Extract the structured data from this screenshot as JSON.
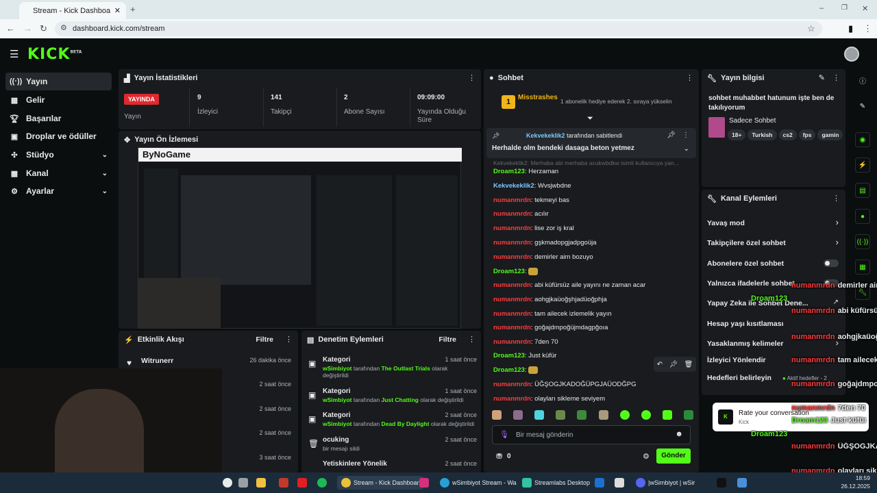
{
  "browser": {
    "tab_title": "Stream - Kick Dashboard",
    "url": "dashboard.kick.com/stream"
  },
  "header": {
    "logo": "KICK",
    "logo_badge": "BETA"
  },
  "sidebar": {
    "items": [
      {
        "label": "Yayın",
        "icon": "broadcast-icon"
      },
      {
        "label": "Gelir",
        "icon": "revenue-icon"
      },
      {
        "label": "Başarılar",
        "icon": "trophy-icon"
      },
      {
        "label": "Droplar ve ödüller",
        "icon": "gift-icon"
      },
      {
        "label": "Stüdyo",
        "icon": "studio-icon"
      },
      {
        "label": "Kanal",
        "icon": "channel-icon"
      },
      {
        "label": "Ayarlar",
        "icon": "gear-icon"
      }
    ]
  },
  "stats": {
    "title": "Yayın İstatistikleri",
    "live_badge": "YAYINDA",
    "live_label": "Yayın",
    "items": [
      {
        "value": "9",
        "label": "İzleyici"
      },
      {
        "value": "141",
        "label": "Takipçi"
      },
      {
        "value": "2",
        "label": "Abone Sayısı"
      },
      {
        "value": "09:09:00",
        "label": "Yayında Olduğu Süre"
      }
    ]
  },
  "preview": {
    "title": "Yayın Ön İzlemesi",
    "brand": "ByNoGame"
  },
  "activity": {
    "title": "Etkinlik Akışı",
    "filter": "Filtre",
    "items": [
      {
        "name": "Witrunerr",
        "time": "26 dakika önce"
      },
      {
        "name": "",
        "time": "2 saat önce"
      },
      {
        "name": "",
        "time": "2 saat önce"
      },
      {
        "name": "",
        "time": "2 saat önce"
      },
      {
        "name": "",
        "time": "3 saat önce"
      }
    ]
  },
  "moderation": {
    "title": "Denetim Eylemleri",
    "filter": "Filtre",
    "items": [
      {
        "title": "Kategori",
        "time": "1 saat önce",
        "by": "wSimbiyot",
        "mid": "tarafından",
        "target": "The Outlast Trials",
        "tail": "olarak değiştirildi"
      },
      {
        "title": "Kategori",
        "time": "1 saat önce",
        "by": "wSimbiyot",
        "mid": "tarafından",
        "target": "Just Chatting",
        "tail": "olarak değiştirildi"
      },
      {
        "title": "Kategori",
        "time": "2 saat önce",
        "by": "wSimbiyot",
        "mid": "tarafından",
        "target": "Dead By Daylight",
        "tail": "olarak değiştirildi"
      },
      {
        "title": "ocuking",
        "time": "2 saat önce",
        "by": "",
        "mid": "bir mesajı sildi",
        "target": "",
        "tail": ""
      },
      {
        "title": "Yetiskinlere Yönelik",
        "time": "2 saat önce",
        "by": "",
        "mid": "",
        "target": "",
        "tail": ""
      }
    ]
  },
  "chat": {
    "title": "Sohbet",
    "gifter": "Misstrashes",
    "gifter_rank": "1",
    "gift_text": "1 abonelik hediye ederek 2. sıraya yükselin",
    "pinned_user": "Kekvekeklik2",
    "pinned_suffix": "tarafından sabitlendi",
    "pinned_text": "Herhalde olm bendeki dasaga beton yetmez",
    "faded_line": "Kekvekeklik2: Merhaba abi merhaba acukwbdkw isimli kullanıcıya yan...",
    "messages": [
      {
        "user": "Droam123",
        "color": "green",
        "text": "Herzaman"
      },
      {
        "user": "Kekvekeklik2",
        "color": "blue",
        "text": "Wvsjwbdne"
      },
      {
        "user": "numanmrdn",
        "color": "red",
        "text": "tekmeyi bas"
      },
      {
        "user": "numanmrdn",
        "color": "red",
        "text": "acılır"
      },
      {
        "user": "numanmrdn",
        "color": "red",
        "text": "lise zor iş kral"
      },
      {
        "user": "numanmrdn",
        "color": "red",
        "text": "gşkmadopgjadpgoüja"
      },
      {
        "user": "numanmrdn",
        "color": "red",
        "text": "demirler aim bozuyo"
      },
      {
        "user": "Droam123",
        "color": "green",
        "text": ""
      },
      {
        "user": "numanmrdn",
        "color": "red",
        "text": "abi küfürsüz aile yayını ne zaman acar"
      },
      {
        "user": "numanmrdn",
        "color": "red",
        "text": "aohgjkaüoğşhjadüoğphja"
      },
      {
        "user": "numanmrdn",
        "color": "red",
        "text": "tam ailecek izlemelik yayın"
      },
      {
        "user": "numanmrdn",
        "color": "red",
        "text": "goğajdmpoğüjmdagpğoıa"
      },
      {
        "user": "numanmrdn",
        "color": "red",
        "text": "7den 70"
      },
      {
        "user": "Droam123",
        "color": "green",
        "text": "Just küfür"
      },
      {
        "user": "Droam123",
        "color": "green",
        "text": ""
      },
      {
        "user": "numanmrdn",
        "color": "red",
        "text": "ÜĞŞOGJKADOĞÜPGJAÜODĞPG"
      },
      {
        "user": "numanmrdn",
        "color": "red",
        "text": "olayları sikleme seviyem"
      }
    ],
    "input_placeholder": "Bir mesaj gönderin",
    "points": "0",
    "send_label": "Gönder"
  },
  "stream_info": {
    "title": "Yayın bilgisi",
    "stream_title": "sohbet muhabbet hatunum işte ben de takılıyorum",
    "category": "Sadece Sohbet",
    "tags": [
      "18+",
      "Turkish",
      "cs2",
      "fps",
      "gamin"
    ]
  },
  "channel_actions": {
    "title": "Kanal Eylemleri",
    "items": [
      {
        "label": "Yavaş mod",
        "control": "chevron"
      },
      {
        "label": "Takipçilere özel sohbet",
        "control": "chevron"
      },
      {
        "label": "Abonelere özel sohbet",
        "control": "toggle"
      },
      {
        "label": "Yalnızca ifadelerle sohbet",
        "control": "toggle"
      },
      {
        "label": "Yapay Zeka ile Sohbet Dene...",
        "control": "external"
      },
      {
        "label": "Hesap yaşı kısıtlaması",
        "control": "chevron"
      },
      {
        "label": "Yasaklanmış kelimeler",
        "control": "chevron"
      },
      {
        "label": "İzleyici Yönlendir",
        "control": "none"
      },
      {
        "label": "Hedefleri belirleyin",
        "control": "chevron",
        "note": "Aktif hedefler - 2"
      }
    ]
  },
  "toast": {
    "text": "Rate your conversation",
    "sub": "Kick"
  },
  "overlay_chat": [
    {
      "user": "numanmrdn",
      "text": "demirler aim bozuyo"
    },
    {
      "user": "Droam123",
      "text": ""
    },
    {
      "user": "numanmrdn",
      "text": "abi küfürsüz aile yayını ne zaman acar"
    },
    {
      "user": "numanmrdn",
      "text": "aohgjkaüoğşhjadüoğphja"
    },
    {
      "user": "numanmrdn",
      "text": "tam ailecek izlemelik yayın"
    },
    {
      "user": "numanmrdn",
      "text": "goğajdmpoğüjmdagpğoıa"
    },
    {
      "user": "numanmrdn",
      "text": "7den 70"
    },
    {
      "user": "Droam123",
      "text": "Just küfür"
    },
    {
      "user": "Droam123",
      "text": ""
    },
    {
      "user": "numanmrdn",
      "text": "ÜĞŞOGJKADOĞÜPGJAÜODĞPG"
    },
    {
      "user": "numanmrdn",
      "text": "olayları sikleme seviyem"
    }
  ],
  "taskbar": {
    "apps": [
      {
        "label": "Stream - Kick Dashboar"
      },
      {
        "label": "wSimbiyot Stream - Wa"
      },
      {
        "label": "Streamlabs Desktop"
      },
      {
        "label": "|wSimbiyot | wSir"
      }
    ],
    "time": "18:59",
    "date": "26.12.2025"
  },
  "colors": {
    "accent": "#53fc18",
    "live": "#e0292f",
    "user_red": "#ff3b3b",
    "panel": "#191b1f"
  }
}
